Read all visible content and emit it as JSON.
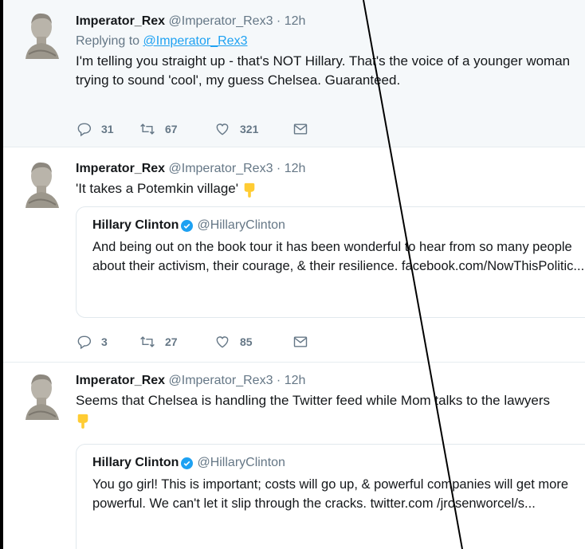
{
  "tweets": [
    {
      "name": "Imperator_Rex",
      "handle": "@Imperator_Rex3",
      "separator": "·",
      "time": "12h",
      "reply_prefix": "Replying to",
      "reply_handle": "@Imperator_Rex3",
      "text": "I'm telling you straight up - that's NOT Hillary. That's the voice of a younger woman trying to sound 'cool', my guess Chelsea. Guaranteed.",
      "replies": "31",
      "retweets": "67",
      "likes": "321"
    },
    {
      "name": "Imperator_Rex",
      "handle": "@Imperator_Rex3",
      "separator": "·",
      "time": "12h",
      "text": "'It takes a Potemkin village'",
      "quote": {
        "name": "Hillary Clinton",
        "handle": "@HillaryClinton",
        "text": "And being out on the book tour it has been wonderful to hear from so many people about their activism, their courage, & their resilience. facebook.com/NowThisPolitic..."
      },
      "replies": "3",
      "retweets": "27",
      "likes": "85"
    },
    {
      "name": "Imperator_Rex",
      "handle": "@Imperator_Rex3",
      "separator": "·",
      "time": "12h",
      "text": "Seems that Chelsea is handling the Twitter feed while Mom talks to the lawyers",
      "quote": {
        "name": "Hillary Clinton",
        "handle": "@HillaryClinton",
        "text": "You go girl! This is important; costs will go up, & powerful companies will get more powerful. We can't let it slip through the cracks. twitter.com /jrosenworcel/s..."
      }
    }
  ],
  "icons": {
    "reply": "reply-icon",
    "retweet": "retweet-icon",
    "like": "heart-icon",
    "dm": "envelope-icon",
    "verified": "verified-badge-icon",
    "emoji": "pointing-down-hand-emoji"
  },
  "colors": {
    "link": "#1da1f2",
    "muted": "#657786",
    "highlight_bg": "#f5f8fa",
    "verified": "#1da1f2",
    "emoji": "#ffcc33"
  }
}
